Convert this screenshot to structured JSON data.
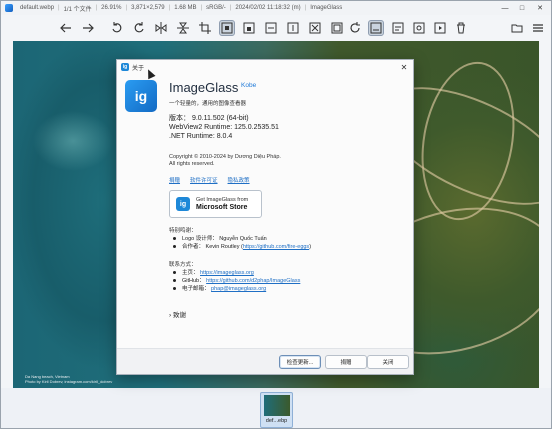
{
  "titlebar": {
    "filename": "default.webp",
    "file_index": "1/1 个文件",
    "zoom": "26.91%",
    "dimensions": "3,871×2,579",
    "filesize": "1.68 MB",
    "colorspace": "sRGB/-",
    "datetime": "2024/02/02 11:18:32 (m)",
    "app_name": "ImageGlass",
    "controls": {
      "minimize": "—",
      "maximize": "□",
      "close": "✕"
    }
  },
  "toolbar": {
    "icons": [
      "back-icon",
      "forward-icon",
      "rotate-left-icon",
      "rotate-right-icon",
      "flip-horizontal-icon",
      "flip-vertical-icon",
      "crop-icon",
      "auto-zoom-icon",
      "lock-zoom-icon",
      "scale-width-icon",
      "scale-height-icon",
      "scale-fit-icon",
      "refresh-icon",
      "checkerboard-icon",
      "gallery-icon",
      "fullscreen-icon",
      "slideshow-icon",
      "delete-icon",
      "open-file-icon",
      "menu-icon"
    ]
  },
  "viewer": {
    "caption_line1": "Da Nang beach, Vietnam",
    "caption_line2": "Photo by Kiril Dobrev, instagram.com/kiril_dobrev"
  },
  "thumbnail": {
    "label": "def...ebp"
  },
  "dialog": {
    "title": "关于",
    "close": "✕",
    "app_name": "ImageGlass",
    "app_code": "Kobe",
    "description": "一个轻量的，通用的图像查看器",
    "version": "版本：    9.0.11.502 (64-bit)",
    "webview": "WebView2 Runtime: 125.0.2535.51",
    "dotnet": ".NET Runtime: 8.0.4",
    "copyright": "Copyright © 2010-2024 by Dương Diệu Pháp.",
    "rights": "All rights reserved.",
    "links": [
      "捐赠",
      "软件许可证",
      "隐私政策"
    ],
    "store": {
      "line1": "Get ImageGlass from",
      "line2": "Microsoft Store"
    },
    "special_thanks_title": "特别鸣谢：",
    "special_thanks": [
      {
        "label": "Logo 设计师：",
        "value": "Nguyễn Quốc Tuấn",
        "link": ""
      },
      {
        "label": "合作者：",
        "value": "Kevin Routley (",
        "link": "https://github.com/fire-eggs",
        "tail": ")"
      }
    ],
    "contact_title": "联系方式：",
    "contact": [
      {
        "label": "主页：",
        "link": "https://imageglass.org"
      },
      {
        "label": "GitHub：",
        "link": "https://github.com/d2phap/ImageGlass"
      },
      {
        "label": "电子邮箱：",
        "link": "phap@imageglass.org"
      }
    ],
    "thanks": "致谢",
    "buttons": {
      "check_update": "检查更新...",
      "report": "捐赠",
      "close": "关闭"
    }
  }
}
